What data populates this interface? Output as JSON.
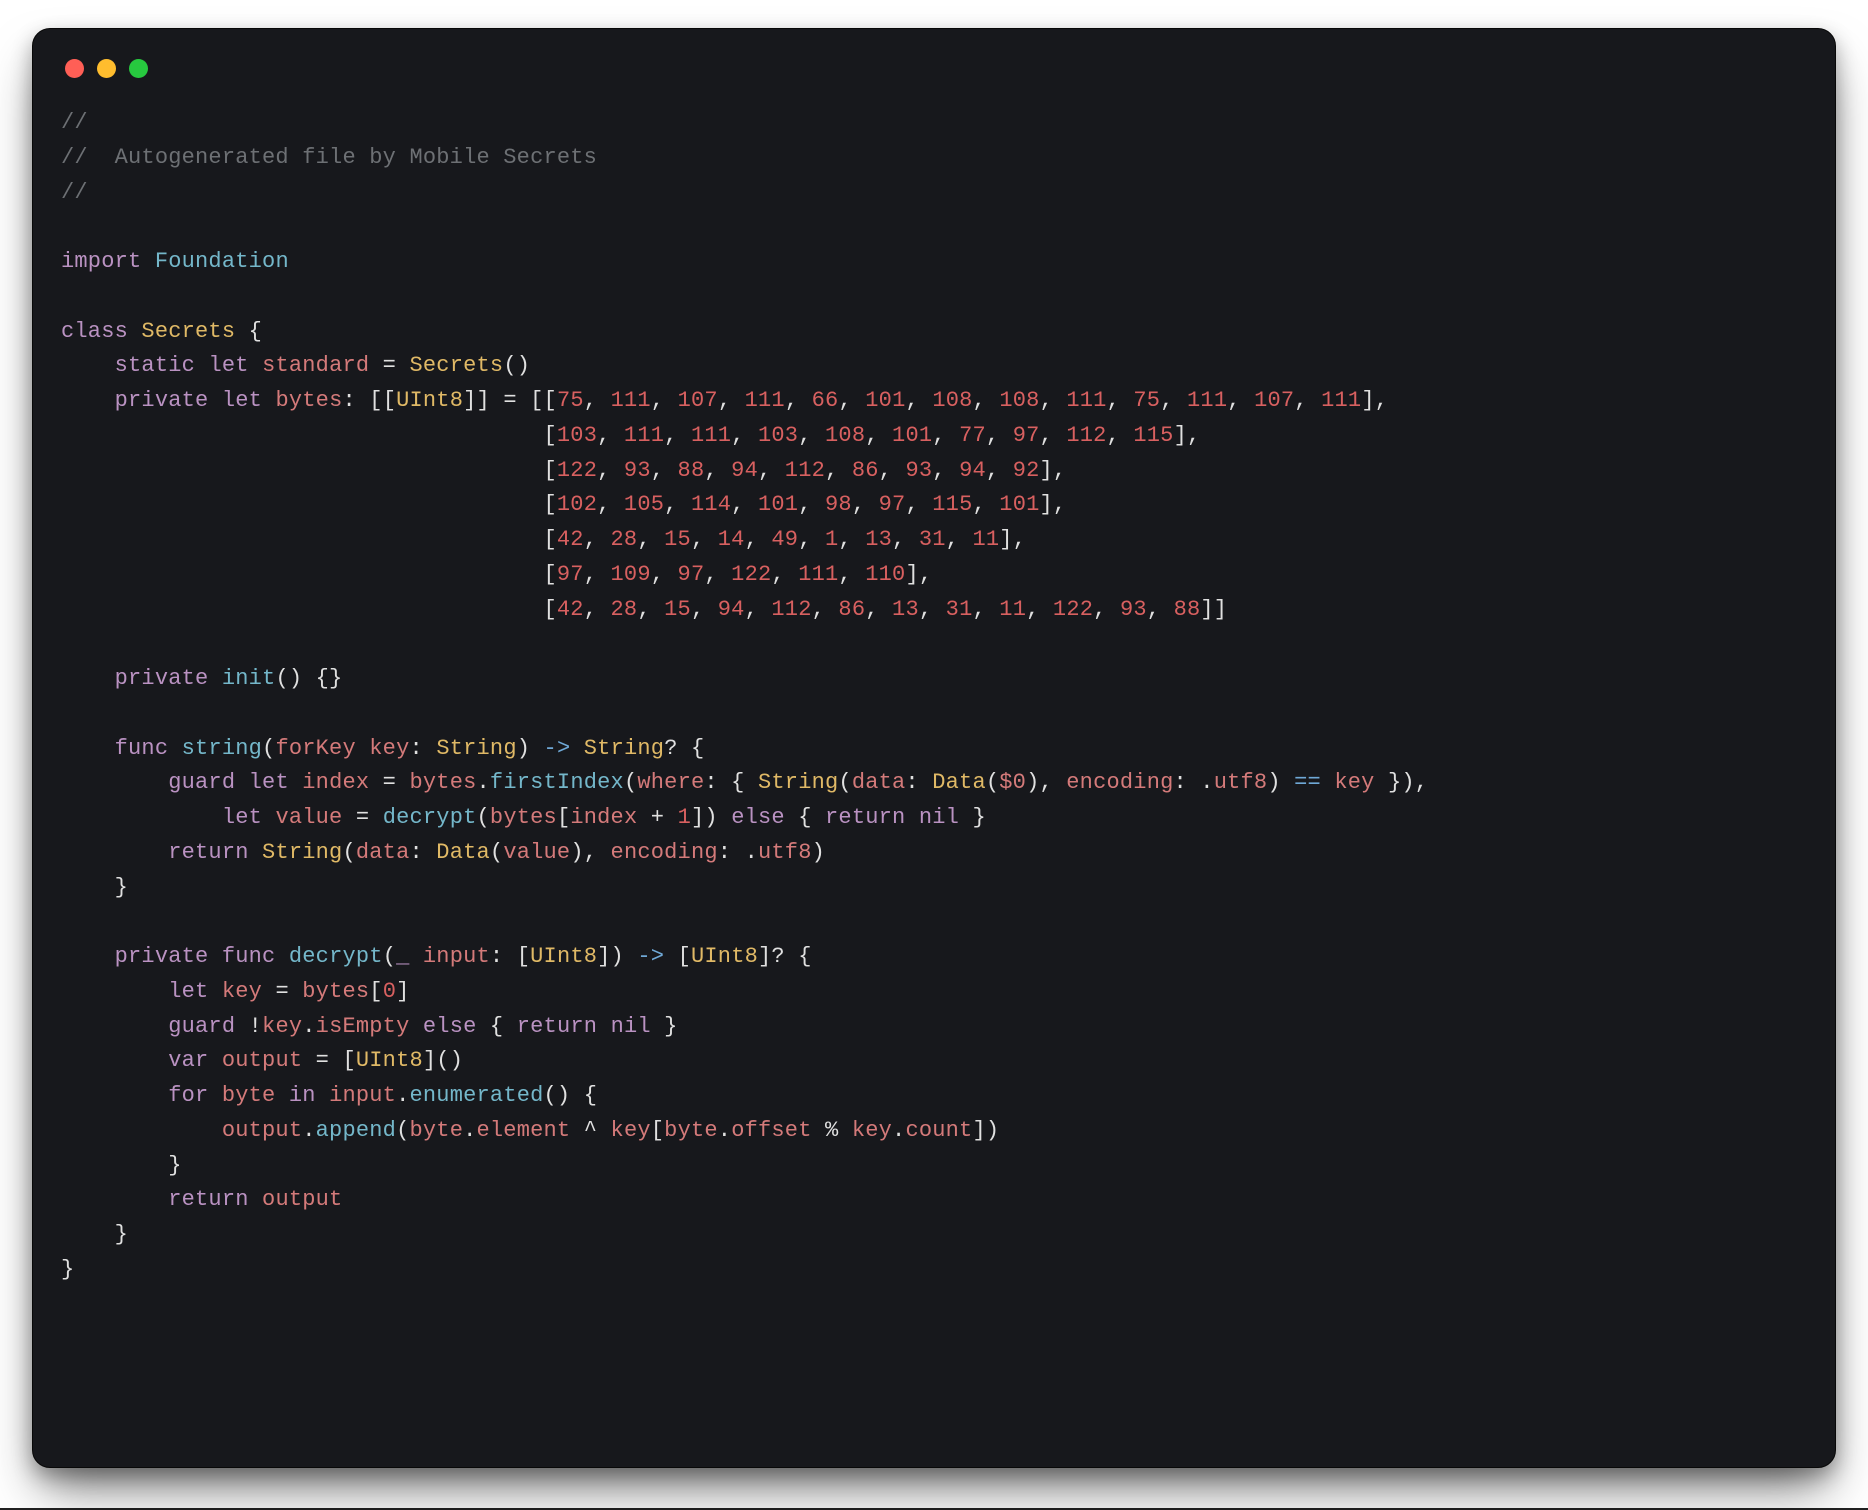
{
  "window": {
    "traffic_lights": [
      "close",
      "minimize",
      "zoom"
    ]
  },
  "code": {
    "language": "swift",
    "header_comment_lines": [
      "//",
      "//  Autogenerated file by Mobile Secrets",
      "//"
    ],
    "import_kw": "import",
    "import_module": "Foundation",
    "class_kw": "class",
    "class_name": "Secrets",
    "static_kw": "static",
    "let_kw": "let",
    "private_kw": "private",
    "var_kw": "var",
    "func_kw": "func",
    "guard_kw": "guard",
    "else_kw": "else",
    "return_kw": "return",
    "nil_kw": "nil",
    "for_kw": "for",
    "in_kw": "in",
    "standard_prop": "standard",
    "secrets_ctor": "Secrets",
    "bytes_prop": "bytes",
    "uint8_type": "UInt8",
    "bytes_arrays": [
      [
        75,
        111,
        107,
        111,
        66,
        101,
        108,
        108,
        111,
        75,
        111,
        107,
        111
      ],
      [
        103,
        111,
        111,
        103,
        108,
        101,
        77,
        97,
        112,
        115
      ],
      [
        122,
        93,
        88,
        94,
        112,
        86,
        93,
        94,
        92
      ],
      [
        102,
        105,
        114,
        101,
        98,
        97,
        115,
        101
      ],
      [
        42,
        28,
        15,
        14,
        49,
        1,
        13,
        31,
        11
      ],
      [
        97,
        109,
        97,
        122,
        111,
        110
      ],
      [
        42,
        28,
        15,
        94,
        112,
        86,
        13,
        31,
        11,
        122,
        93,
        88
      ]
    ],
    "init_name": "init",
    "string_fn": "string",
    "forKey_label": "forKey",
    "key_param": "key",
    "String_type": "String",
    "index_var": "index",
    "firstIndex_fn": "firstIndex",
    "where_label": "where",
    "data_label": "data",
    "Data_ctor": "Data",
    "dollar0": "$0",
    "encoding_label": "encoding",
    "utf8_member": "utf8",
    "value_var": "value",
    "decrypt_fn": "decrypt",
    "plus_one": "1",
    "zero": "0",
    "input_param": "input",
    "key_var": "key",
    "isEmpty_prop": "isEmpty",
    "output_var": "output",
    "byte_var": "byte",
    "enumerated_fn": "enumerated",
    "append_fn": "append",
    "element_prop": "element",
    "offset_prop": "offset",
    "count_prop": "count"
  }
}
